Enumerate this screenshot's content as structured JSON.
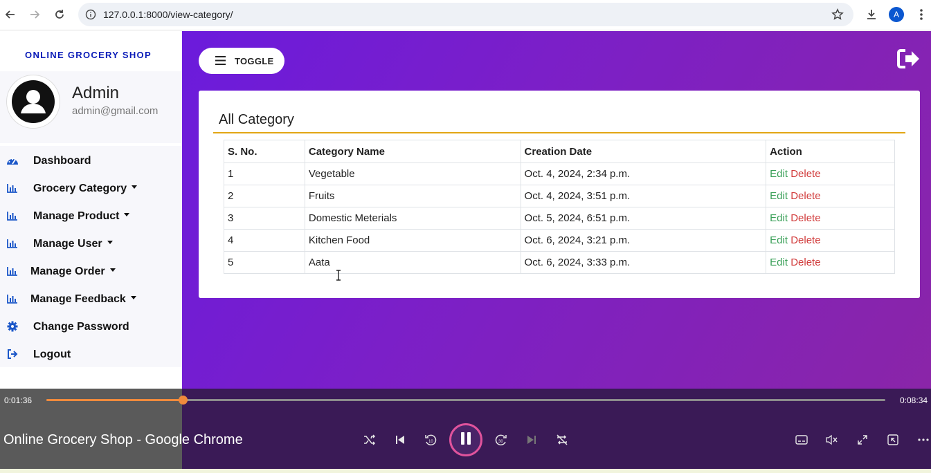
{
  "browser": {
    "url": "127.0.0.1:8000/view-category/",
    "profile_initial": "A"
  },
  "sidebar": {
    "brand": "ONLINE GROCERY SHOP",
    "profile": {
      "name": "Admin",
      "email": "admin@gmail.com"
    },
    "items": [
      {
        "label": "Dashboard",
        "icon": "dashboard-icon",
        "dropdown": false
      },
      {
        "label": "Grocery Category",
        "icon": "bar-chart-icon",
        "dropdown": true
      },
      {
        "label": "Manage Product",
        "icon": "bar-chart-icon",
        "dropdown": true
      },
      {
        "label": "Manage User",
        "icon": "bar-chart-icon",
        "dropdown": true
      },
      {
        "label": "Manage Order",
        "icon": "bar-chart-icon",
        "dropdown": true
      },
      {
        "label": "Manage Feedback",
        "icon": "bar-chart-icon",
        "dropdown": true
      },
      {
        "label": "Change Password",
        "icon": "gear-icon",
        "dropdown": false
      },
      {
        "label": "Logout",
        "icon": "sign-out-icon",
        "dropdown": false
      }
    ]
  },
  "main": {
    "toggle_label": "TOGGLE",
    "card_title": "All Category",
    "table": {
      "headers": [
        "S. No.",
        "Category Name",
        "Creation Date",
        "Action"
      ],
      "rows": [
        {
          "sno": "1",
          "name": "Vegetable",
          "date": "Oct. 4, 2024, 2:34 p.m.",
          "edit": "Edit",
          "delete": "Delete"
        },
        {
          "sno": "2",
          "name": "Fruits",
          "date": "Oct. 4, 2024, 3:51 p.m.",
          "edit": "Edit",
          "delete": "Delete"
        },
        {
          "sno": "3",
          "name": "Domestic Meterials",
          "date": "Oct. 5, 2024, 6:51 p.m.",
          "edit": "Edit",
          "delete": "Delete"
        },
        {
          "sno": "4",
          "name": "Kitchen Food",
          "date": "Oct. 6, 2024, 3:21 p.m.",
          "edit": "Edit",
          "delete": "Delete"
        },
        {
          "sno": "5",
          "name": "Aata",
          "date": "Oct. 6, 2024, 3:33 p.m.",
          "edit": "Edit",
          "delete": "Delete"
        }
      ]
    }
  },
  "media": {
    "elapsed": "0:01:36",
    "duration": "0:08:34",
    "progress": 0.1626,
    "title": "Online Grocery Shop - Google Chrome"
  },
  "colors": {
    "accent_blue": "#1a56c8",
    "brand_blue": "#0a1cb8",
    "rule_gold": "#e2a614",
    "edit_green": "#3aa058",
    "delete_red": "#d13b3b",
    "progress_orange": "#f08a3c"
  }
}
